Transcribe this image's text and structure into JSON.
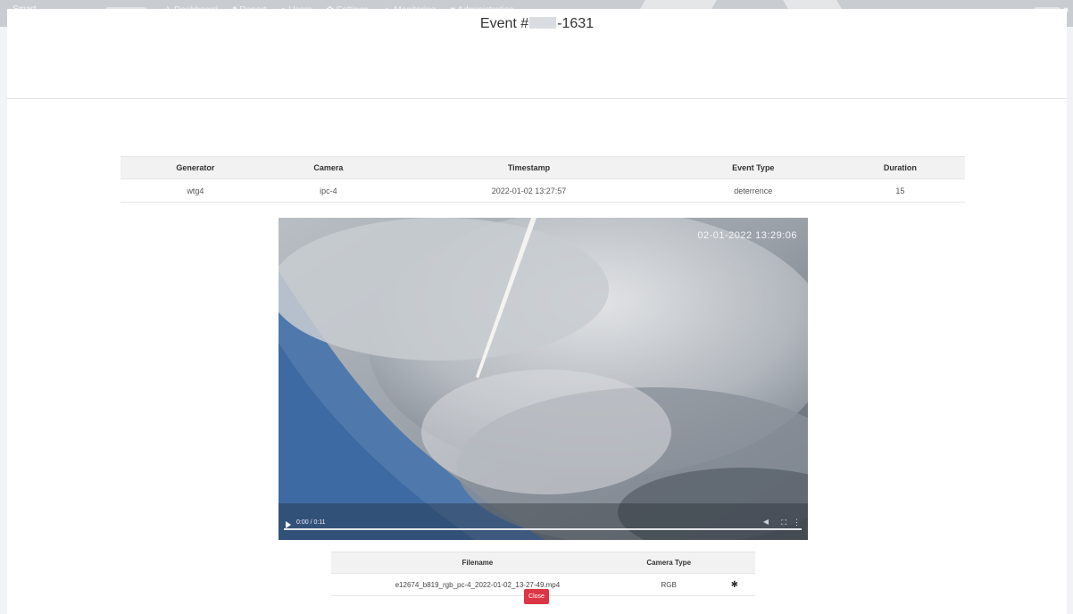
{
  "nav": {
    "logo": "Smart",
    "menu": [
      {
        "icon": "dashboard-icon",
        "glyph": "✈",
        "label": "Dashboard"
      },
      {
        "icon": "report-icon",
        "glyph": "▮",
        "label": "Report"
      },
      {
        "icon": "users-icon",
        "glyph": "●",
        "label": "Users"
      },
      {
        "icon": "settings-icon",
        "glyph": "✿",
        "label": "Settings"
      },
      {
        "icon": "monitoring-icon",
        "glyph": "▲",
        "label": "Monitoring"
      },
      {
        "icon": "administration-icon",
        "glyph": "■",
        "label": "Administration"
      }
    ]
  },
  "modal": {
    "title_prefix": "Event #",
    "title_suffix": "-1631",
    "info_table": {
      "headers": [
        "Generator",
        "Camera",
        "Timestamp",
        "Event Type",
        "Duration"
      ],
      "row": [
        "wtg4",
        "ipc-4",
        "2022-01-02 13:27:57",
        "deterrence",
        "15"
      ]
    },
    "video": {
      "overlay_timestamp": "02-01-2022 13:29:06",
      "time": "0:00 / 0:11"
    },
    "file_table": {
      "headers": [
        "Filename",
        "Camera Type",
        ""
      ],
      "row": [
        "e12674_b819_rgb_pc-4_2022-01-02_13-27-49.mp4",
        "RGB"
      ]
    },
    "close_label": "Close"
  },
  "colors": {
    "danger": "#dc3545",
    "nav_bg": "#c9cdd2",
    "table_header_bg": "#f2f2f2"
  }
}
